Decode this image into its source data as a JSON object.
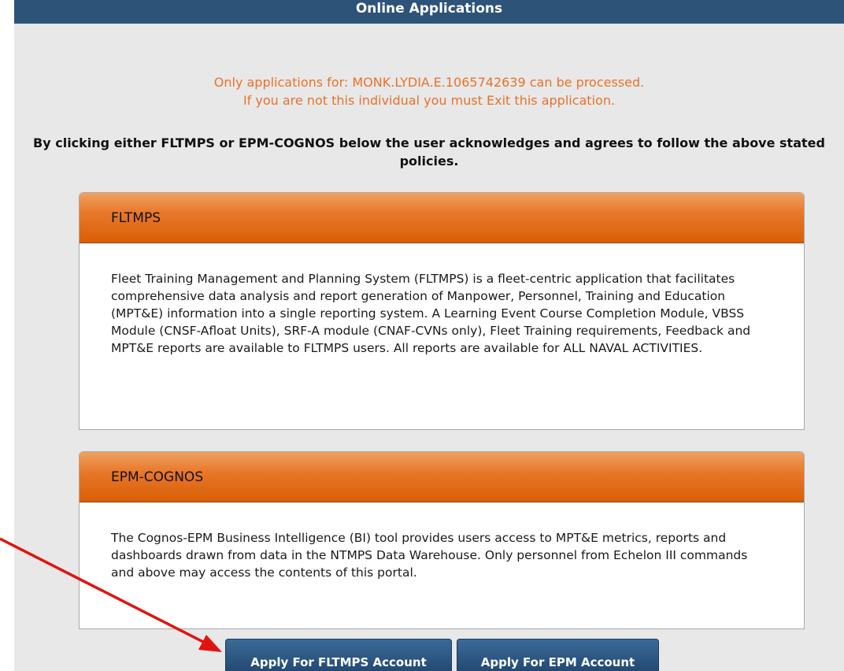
{
  "header": {
    "title": "Online Applications"
  },
  "notice": {
    "line1": "Only applications for: MONK.LYDIA.E.1065742639 can be processed.",
    "line2": "If you are not this individual you must Exit this application."
  },
  "acknowledgement": {
    "text": "By clicking either FLTMPS or EPM-COGNOS below the user acknowledges and agrees to follow the above stated policies."
  },
  "cards": {
    "fltmps": {
      "title": "FLTMPS",
      "description": "Fleet Training Management and Planning System (FLTMPS) is a fleet-centric application that facilitates comprehensive data analysis and report generation of Manpower, Personnel, Training and Education (MPT&E) information into a single reporting system. A Learning Event Course Completion Module, VBSS Module (CNSF-Afloat Units), SRF-A module (CNAF-CVNs only), Fleet Training requirements, Feedback and MPT&E reports are available to FLTMPS users. All reports are available for ALL NAVAL ACTIVITIES."
    },
    "epm": {
      "title": "EPM-COGNOS",
      "description": "The Cognos-EPM Business Intelligence (BI) tool provides users access to MPT&E metrics, reports and dashboards drawn from data in the NTMPS Data Warehouse. Only personnel from Echelon III commands and above may access the contents of this portal."
    }
  },
  "buttons": {
    "apply_fltmps": "Apply For FLTMPS Account",
    "apply_epm": "Apply For EPM Account"
  },
  "colors": {
    "header_bar": "#2e5378",
    "notice_text": "#e8722b",
    "card_header": "#e06a12",
    "button": "#2e5a86",
    "annotation_arrow": "#e0140f"
  }
}
